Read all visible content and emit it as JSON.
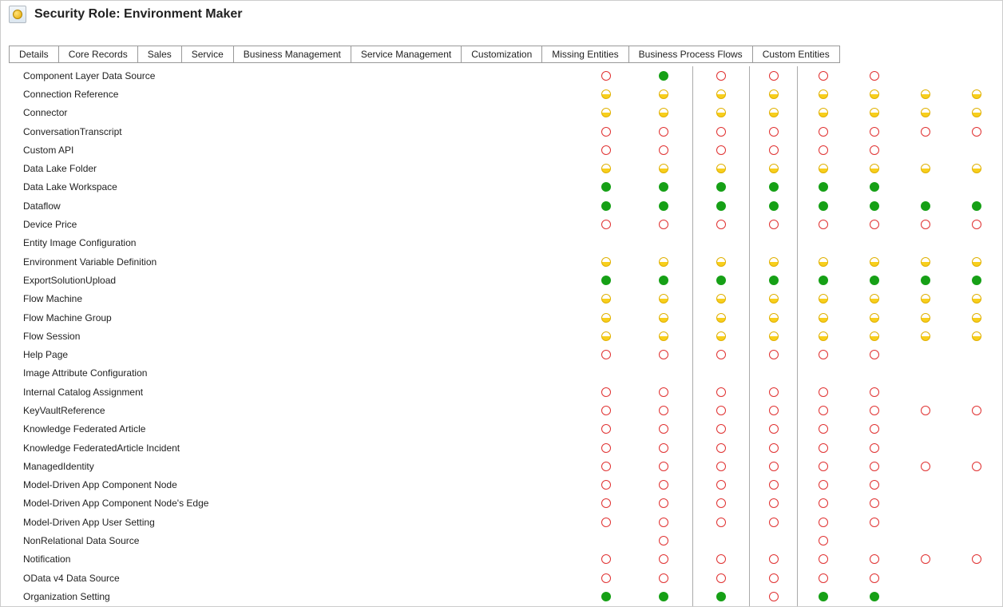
{
  "header": {
    "title": "Security Role: Environment Maker"
  },
  "tabs": [
    "Details",
    "Core Records",
    "Sales",
    "Service",
    "Business Management",
    "Service Management",
    "Customization",
    "Missing Entities",
    "Business Process Flows",
    "Custom Entities"
  ],
  "entities": [
    {
      "name": "Component Layer Data Source",
      "perms": [
        "none",
        "org",
        "",
        "none",
        "none",
        "",
        "none",
        "none"
      ]
    },
    {
      "name": "Connection Reference",
      "perms": [
        "user",
        "user",
        "",
        "user",
        "user",
        "",
        "user",
        "user",
        "user",
        "user"
      ]
    },
    {
      "name": "Connector",
      "perms": [
        "user",
        "user",
        "",
        "user",
        "user",
        "",
        "user",
        "user",
        "user",
        "user"
      ]
    },
    {
      "name": "ConversationTranscript",
      "perms": [
        "none",
        "none",
        "",
        "none",
        "none",
        "",
        "none",
        "none",
        "none",
        "none"
      ]
    },
    {
      "name": "Custom API",
      "perms": [
        "none",
        "none",
        "",
        "none",
        "none",
        "",
        "none",
        "none"
      ]
    },
    {
      "name": "Data Lake Folder",
      "perms": [
        "user",
        "user",
        "",
        "user",
        "user",
        "",
        "user",
        "user",
        "user",
        "user"
      ]
    },
    {
      "name": "Data Lake Workspace",
      "perms": [
        "org",
        "org",
        "",
        "org",
        "org",
        "",
        "org",
        "org"
      ]
    },
    {
      "name": "Dataflow",
      "perms": [
        "org",
        "org",
        "",
        "org",
        "org",
        "",
        "org",
        "org",
        "org",
        "org"
      ]
    },
    {
      "name": "Device Price",
      "perms": [
        "none",
        "none",
        "",
        "none",
        "none",
        "",
        "none",
        "none",
        "none",
        "none"
      ]
    },
    {
      "name": "Entity Image Configuration",
      "perms": [
        "",
        "",
        "",
        "",
        "",
        "",
        "",
        ""
      ]
    },
    {
      "name": "Environment Variable Definition",
      "perms": [
        "user",
        "user",
        "",
        "user",
        "user",
        "",
        "user",
        "user",
        "user",
        "user"
      ]
    },
    {
      "name": "ExportSolutionUpload",
      "perms": [
        "org",
        "org",
        "",
        "org",
        "org",
        "",
        "org",
        "org",
        "org",
        "org"
      ]
    },
    {
      "name": "Flow Machine",
      "perms": [
        "user",
        "user",
        "",
        "user",
        "user",
        "",
        "user",
        "user",
        "user",
        "user"
      ]
    },
    {
      "name": "Flow Machine Group",
      "perms": [
        "user",
        "user",
        "",
        "user",
        "user",
        "",
        "user",
        "user",
        "user",
        "user"
      ]
    },
    {
      "name": "Flow Session",
      "perms": [
        "user",
        "user",
        "",
        "user",
        "user",
        "",
        "user",
        "user",
        "user",
        "user"
      ]
    },
    {
      "name": "Help Page",
      "perms": [
        "none",
        "none",
        "",
        "none",
        "none",
        "",
        "none",
        "none"
      ]
    },
    {
      "name": "Image Attribute Configuration",
      "perms": [
        "",
        "",
        "",
        "",
        "",
        "",
        "",
        ""
      ]
    },
    {
      "name": "Internal Catalog Assignment",
      "perms": [
        "none",
        "none",
        "",
        "none",
        "none",
        "",
        "none",
        "none"
      ]
    },
    {
      "name": "KeyVaultReference",
      "perms": [
        "none",
        "none",
        "",
        "none",
        "none",
        "",
        "none",
        "none",
        "none",
        "none"
      ]
    },
    {
      "name": "Knowledge Federated Article",
      "perms": [
        "none",
        "none",
        "",
        "none",
        "none",
        "",
        "none",
        "none"
      ]
    },
    {
      "name": "Knowledge FederatedArticle Incident",
      "perms": [
        "none",
        "none",
        "",
        "none",
        "none",
        "",
        "none",
        "none"
      ]
    },
    {
      "name": "ManagedIdentity",
      "perms": [
        "none",
        "none",
        "",
        "none",
        "none",
        "",
        "none",
        "none",
        "none",
        "none"
      ]
    },
    {
      "name": "Model-Driven App Component Node",
      "perms": [
        "none",
        "none",
        "",
        "none",
        "none",
        "",
        "none",
        "none"
      ]
    },
    {
      "name": "Model-Driven App Component Node's Edge",
      "perms": [
        "none",
        "none",
        "",
        "none",
        "none",
        "",
        "none",
        "none"
      ]
    },
    {
      "name": "Model-Driven App User Setting",
      "perms": [
        "none",
        "none",
        "",
        "none",
        "none",
        "",
        "none",
        "none"
      ]
    },
    {
      "name": "NonRelational Data Source",
      "perms": [
        "",
        "none",
        "",
        "",
        "",
        "",
        "none",
        ""
      ]
    },
    {
      "name": "Notification",
      "perms": [
        "none",
        "none",
        "",
        "none",
        "none",
        "",
        "none",
        "none",
        "none",
        "none"
      ]
    },
    {
      "name": "OData v4 Data Source",
      "perms": [
        "none",
        "none",
        "",
        "none",
        "none",
        "",
        "none",
        "none"
      ]
    },
    {
      "name": "Organization Setting",
      "perms": [
        "org",
        "org",
        "",
        "org",
        "none",
        "",
        "org",
        "org"
      ]
    }
  ]
}
